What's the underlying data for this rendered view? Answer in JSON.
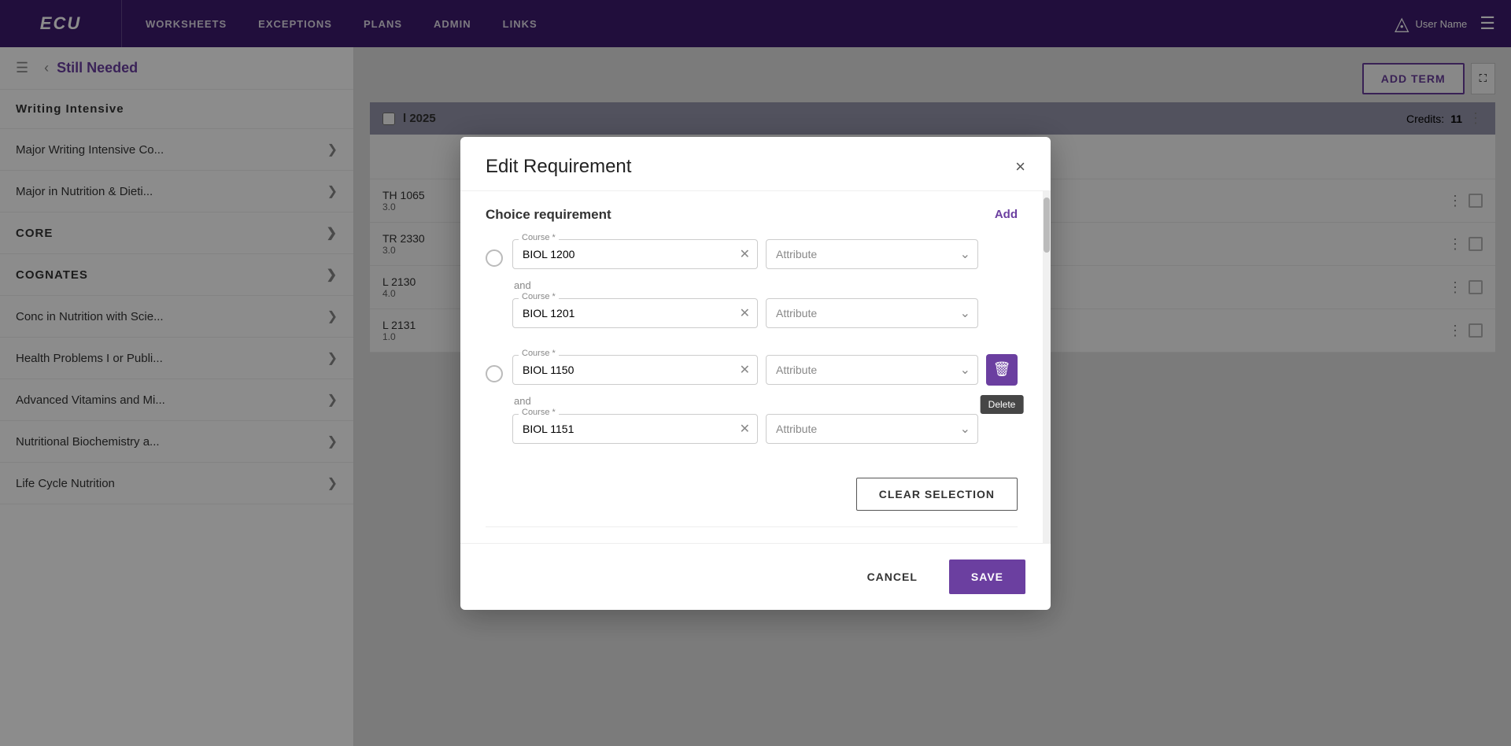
{
  "app": {
    "logo": "ECU",
    "nav_links": [
      "WORKSHEETS",
      "EXCEPTIONS",
      "PLANS",
      "ADMIN",
      "LINKS"
    ],
    "user_name": "User Name",
    "add_term_label": "ADD TERM"
  },
  "sidebar": {
    "title": "Still Needed",
    "items": [
      {
        "label": "Writing Intensive",
        "type": "plain"
      },
      {
        "label": "Major Writing Intensive Co...",
        "type": "link"
      },
      {
        "label": "Major in Nutrition & Dieti...",
        "type": "link"
      },
      {
        "label": "CORE",
        "type": "section"
      },
      {
        "label": "COGNATES",
        "type": "section"
      },
      {
        "label": "Conc in Nutrition with Scie...",
        "type": "link"
      },
      {
        "label": "Health Problems I or Publi...",
        "type": "link"
      },
      {
        "label": "Advanced Vitamins and Mi...",
        "type": "link"
      },
      {
        "label": "Nutritional Biochemistry a...",
        "type": "link"
      },
      {
        "label": "Life Cycle Nutrition",
        "type": "link"
      }
    ]
  },
  "term": {
    "title": "l 2025",
    "credits_label": "Credits:",
    "credits_value": "11"
  },
  "courses": [
    {
      "code": "TH 1065",
      "credits": "3.0"
    },
    {
      "code": "TR 2330",
      "credits": "3.0"
    },
    {
      "code": "L 2130",
      "credits": "4.0"
    },
    {
      "code": "L 2131",
      "credits": "1.0"
    }
  ],
  "modal": {
    "title": "Edit  Requirement",
    "close_label": "×",
    "section_title": "Choice  requirement",
    "add_label": "Add",
    "groups": [
      {
        "rows": [
          {
            "course": "BIOL 1200",
            "course_label": "Course *",
            "attribute": "Attribute"
          },
          {
            "course": "BIOL 1201",
            "course_label": "Course *",
            "attribute": "Attribute"
          }
        ]
      },
      {
        "rows": [
          {
            "course": "BIOL 1150",
            "course_label": "Course *",
            "attribute": "Attribute"
          },
          {
            "course": "BIOL 1151",
            "course_label": "Course *",
            "attribute": "Attribute"
          }
        ]
      }
    ],
    "and_label": "and",
    "clear_selection_label": "CLEAR SELECTION",
    "tooltip_delete": "Delete",
    "cancel_label": "CANCEL",
    "save_label": "SAVE"
  }
}
